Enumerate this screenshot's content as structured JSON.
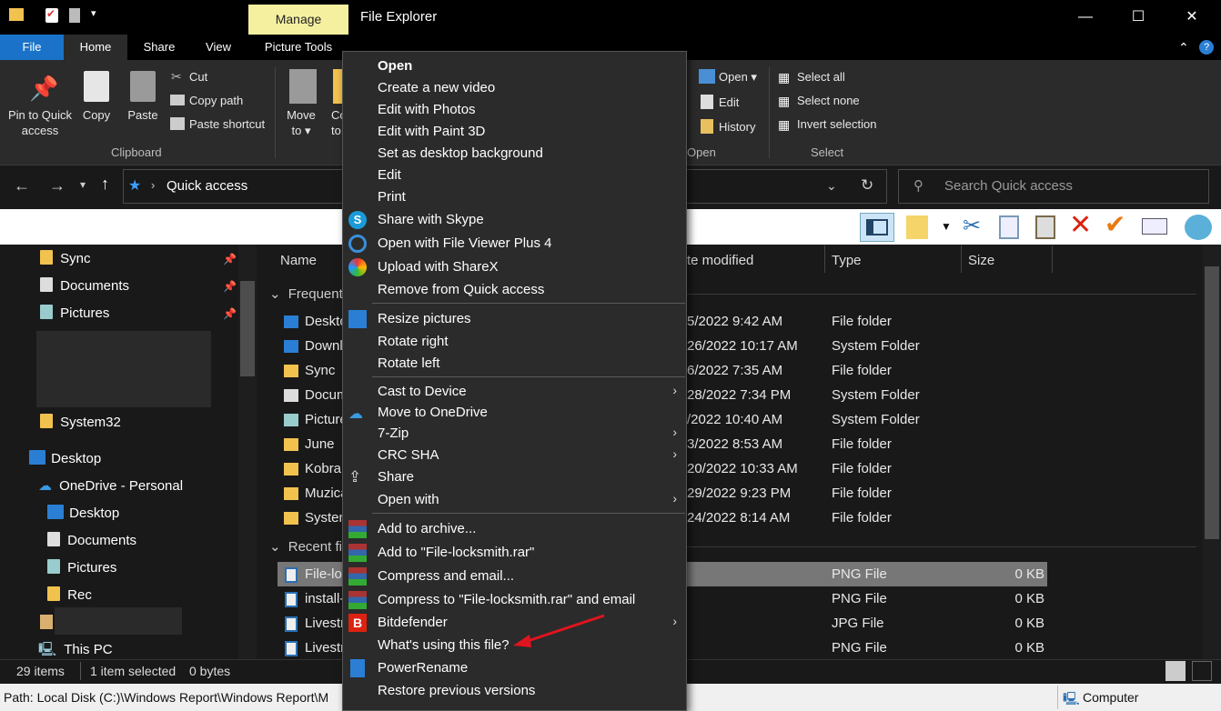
{
  "window": {
    "title": "File Explorer",
    "manage": "Manage",
    "minimize": "—",
    "maximize": "☐",
    "close": "✕"
  },
  "tabs": {
    "file": "File",
    "home": "Home",
    "share": "Share",
    "view": "View",
    "picture_tools": "Picture Tools"
  },
  "ribbon": {
    "pin": [
      "Pin to Quick",
      "access"
    ],
    "copy": "Copy",
    "paste": "Paste",
    "cut": "Cut",
    "copy_path": "Copy path",
    "paste_shortcut": "Paste shortcut",
    "clipboard": "Clipboard",
    "move_to": [
      "Move",
      "to"
    ],
    "copy_to_partial": [
      "Co",
      "to"
    ],
    "open": "Open",
    "edit": "Edit",
    "history": "History",
    "open_group": "Open",
    "select_all": "Select all",
    "select_none": "Select none",
    "invert_selection": "Invert selection",
    "select_group": "Select"
  },
  "address": {
    "path": "Quick access",
    "search_placeholder": "Search Quick access"
  },
  "sidebar": {
    "sync": "Sync",
    "documents": "Documents",
    "pictures": "Pictures",
    "system32": "System32",
    "desktop": "Desktop",
    "onedrive": "OneDrive - Personal",
    "od_desktop": "Desktop",
    "od_documents": "Documents",
    "od_pictures": "Pictures",
    "od_rec": "Rec",
    "this_pc": "This PC"
  },
  "columns": {
    "name": "Name",
    "date": "te modified",
    "type": "Type",
    "size": "Size"
  },
  "groups": {
    "frequent": "Frequent",
    "recent": "Recent fil"
  },
  "frequent_rows": [
    {
      "name": "Deskto",
      "date": "5/2022 9:42 AM",
      "type": "File folder"
    },
    {
      "name": "Downl",
      "date": "26/2022 10:17 AM",
      "type": "System Folder"
    },
    {
      "name": "Sync",
      "date": "6/2022 7:35 AM",
      "type": "File folder"
    },
    {
      "name": "Docum",
      "date": "28/2022 7:34 PM",
      "type": "System Folder"
    },
    {
      "name": "Picture",
      "date": "/2022 10:40 AM",
      "type": "System Folder"
    },
    {
      "name": "June",
      "date": "3/2022 8:53 AM",
      "type": "File folder"
    },
    {
      "name": "Kobra",
      "date": "20/2022 10:33 AM",
      "type": "File folder"
    },
    {
      "name": "Muzica",
      "date": "29/2022 9:23 PM",
      "type": "File folder"
    },
    {
      "name": "Systen",
      "date": "24/2022 8:14 AM",
      "type": "File folder"
    }
  ],
  "recent_rows": [
    {
      "name": "File-lo",
      "type": "PNG File",
      "size": "0 KB"
    },
    {
      "name": "install-",
      "type": "PNG File",
      "size": "0 KB"
    },
    {
      "name": "Livestr",
      "type": "JPG File",
      "size": "0 KB"
    },
    {
      "name": "Livestr",
      "type": "PNG File",
      "size": "0 KB"
    }
  ],
  "status": {
    "items": "29 items",
    "selected": "1 item selected",
    "bytes": "0 bytes"
  },
  "pathbar": {
    "path": "Path: Local Disk (C:)\\Windows Report\\Windows Report\\M",
    "computer": "Computer"
  },
  "menu": {
    "open": "Open",
    "create_video": "Create a new video",
    "edit_photos": "Edit with Photos",
    "edit_paint3d": "Edit with Paint 3D",
    "set_bg": "Set as desktop background",
    "edit": "Edit",
    "print": "Print",
    "skype": "Share with Skype",
    "fileviewer": "Open with File Viewer Plus 4",
    "sharex": "Upload with ShareX",
    "remove_qa": "Remove from Quick access",
    "resize": "Resize pictures",
    "rotate_right": "Rotate right",
    "rotate_left": "Rotate left",
    "cast": "Cast to Device",
    "onedrive": "Move to OneDrive",
    "zip": "7-Zip",
    "crc": "CRC SHA",
    "share": "Share",
    "open_with": "Open with",
    "add_archive": "Add to archive...",
    "add_rar": "Add to \"File-locksmith.rar\"",
    "compress_email": "Compress and email...",
    "compress_rar_email": "Compress to \"File-locksmith.rar\" and email",
    "bitdefender": "Bitdefender",
    "whats_using": "What's using this file?",
    "powerrename": "PowerRename",
    "restore": "Restore previous versions"
  }
}
